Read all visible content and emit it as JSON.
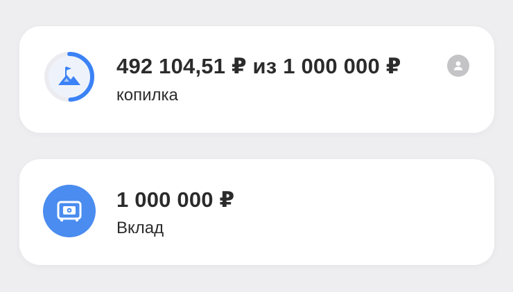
{
  "accent_color": "#3b82f6",
  "savings": {
    "amount": "492 104,51 ₽ из 1 000 000 ₽",
    "label": "копилка",
    "progress": 0.492,
    "icon": "goal-flag-mountain-icon",
    "action_icon": "person-icon"
  },
  "deposit": {
    "amount": "1 000 000 ₽",
    "label": "Вклад",
    "icon": "safe-icon"
  }
}
